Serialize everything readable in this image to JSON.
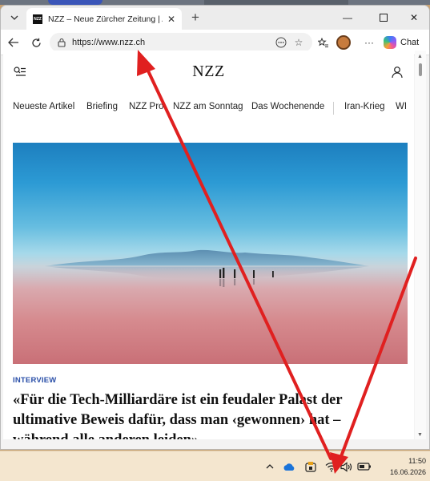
{
  "browser": {
    "tab_title": "NZZ – Neue Zürcher Zeitung | Akt",
    "favicon_text": "NZZ",
    "url": "https://www.nzz.ch",
    "copilot_label": "Chat",
    "icons": {
      "tab_list": "chevron-down-icon",
      "tab_close": "close-icon",
      "new_tab": "plus-icon",
      "minimize": "minimize-icon",
      "maximize": "maximize-icon",
      "close": "close-icon",
      "back": "back-arrow-icon",
      "reload": "reload-icon",
      "lock": "lock-icon",
      "more_url": "more-icon",
      "favorite": "star-icon",
      "favorites_bar": "favorites-icon",
      "more": "ellipsis-icon"
    }
  },
  "page": {
    "logo": "NZZ",
    "nav_items": [
      "Neueste Artikel",
      "Briefing",
      "NZZ Pro",
      "NZZ am Sonntag",
      "Das Wochenende",
      "Iran-Krieg",
      "WI"
    ],
    "article": {
      "kicker": "INTERVIEW",
      "headline": "«Für die Tech-Milliardäre ist ein feudaler Palast der ultimative Beweis dafür, dass man ‹gewonnen› hat – während alle anderen leiden»"
    }
  },
  "taskbar": {
    "time": "11:50",
    "date": "16.06.2026",
    "tray_icons": [
      "chevron-up-icon",
      "onedrive-cloud-icon",
      "security-icon",
      "wifi-icon",
      "volume-icon",
      "battery-icon"
    ]
  },
  "colors": {
    "annotation_arrow": "#e02020",
    "kicker": "#2a4fa8",
    "taskbar": "#f4e6cf"
  }
}
